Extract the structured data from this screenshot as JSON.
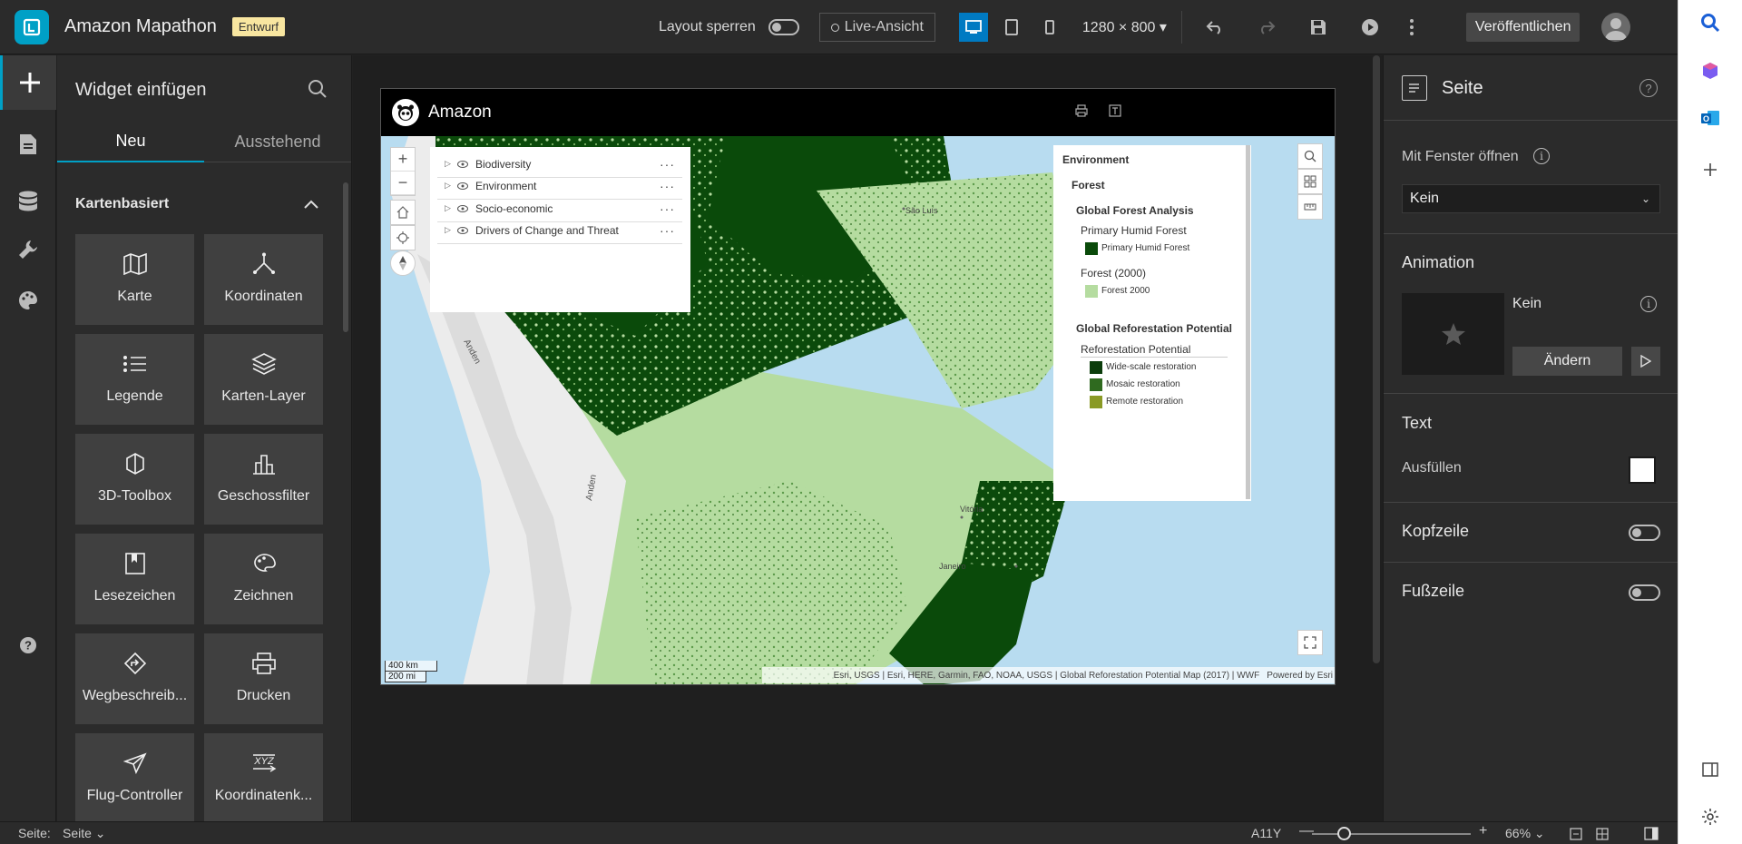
{
  "header": {
    "app_title": "Amazon Mapathon",
    "draft_badge": "Entwurf",
    "lock_layout_label": "Layout sperren",
    "live_view_label": "Live-Ansicht",
    "resolution": "1280 × 800",
    "publish_label": "Veröffentlichen"
  },
  "widget_panel": {
    "title": "Widget einfügen",
    "tabs": [
      "Neu",
      "Ausstehend"
    ],
    "section": "Kartenbasiert",
    "widgets": [
      {
        "label": "Karte",
        "icon": "map-icon"
      },
      {
        "label": "Koordinaten",
        "icon": "coordinates-icon"
      },
      {
        "label": "Legende",
        "icon": "legend-icon"
      },
      {
        "label": "Karten-Layer",
        "icon": "layers-icon"
      },
      {
        "label": "3D-Toolbox",
        "icon": "3d-toolbox-icon"
      },
      {
        "label": "Geschossfilter",
        "icon": "floor-filter-icon"
      },
      {
        "label": "Lesezeichen",
        "icon": "bookmark-icon"
      },
      {
        "label": "Zeichnen",
        "icon": "draw-icon"
      },
      {
        "label": "Wegbeschreib...",
        "icon": "directions-icon"
      },
      {
        "label": "Drucken",
        "icon": "print-icon"
      },
      {
        "label": "Flug-Controller",
        "icon": "fly-controller-icon"
      },
      {
        "label": "Koordinatenk...",
        "icon": "coordinate-conversion-icon"
      }
    ]
  },
  "page": {
    "title": "Amazon",
    "layers": [
      "Biodiversity",
      "Environment",
      "Socio-economic",
      "Drivers of Change and Threat"
    ],
    "legend": {
      "group": "Environment",
      "subgroup": "Forest",
      "analysis_title": "Global Forest Analysis",
      "primary_layer": "Primary Humid Forest",
      "primary_item": "Primary Humid Forest",
      "forest2000_layer": "Forest (2000)",
      "forest2000_item": "Forest 2000",
      "reforestation_title": "Global Reforestation Potential",
      "reforestation_layer": "Reforestation Potential",
      "items": [
        "Wide-scale restoration",
        "Mosaic restoration",
        "Remote restoration"
      ],
      "colors": [
        "#0b3d0b",
        "#2f6a1f",
        "#8a9a25"
      ],
      "primary_color": "#0a4a0a",
      "forest2000_color": "#b5dca0"
    },
    "map_labels": {
      "anden1": "Anden",
      "anden2": "Anden",
      "sao_luis": "São Luís",
      "vitoria": "Vitória",
      "janeiro": "Janeiro"
    },
    "scale_km": "400 km",
    "scale_mi": "200 mi",
    "attribution": "Esri, USGS | Esri, HERE, Garmin, FAO, NOAA, USGS | Global Reforestation Potential Map (2017) | WWF",
    "powered_by": "Powered by Esri"
  },
  "settings_panel": {
    "title": "Seite",
    "open_with_window_label": "Mit Fenster öffnen",
    "open_with_window_value": "Kein",
    "animation_label": "Animation",
    "animation_value": "Kein",
    "change_label": "Ändern",
    "text_label": "Text",
    "fill_label": "Ausfüllen",
    "header_label": "Kopfzeile",
    "footer_label": "Fußzeile"
  },
  "statusbar": {
    "page_label": "Seite:",
    "page_value": "Seite",
    "a11y": "A11Y",
    "zoom": "66%",
    "zoom_fraction": 0.2
  },
  "colors": {
    "accent": "#00a0c6",
    "active_device": "#007ac2",
    "draft_badge": "#f8e6a0"
  }
}
